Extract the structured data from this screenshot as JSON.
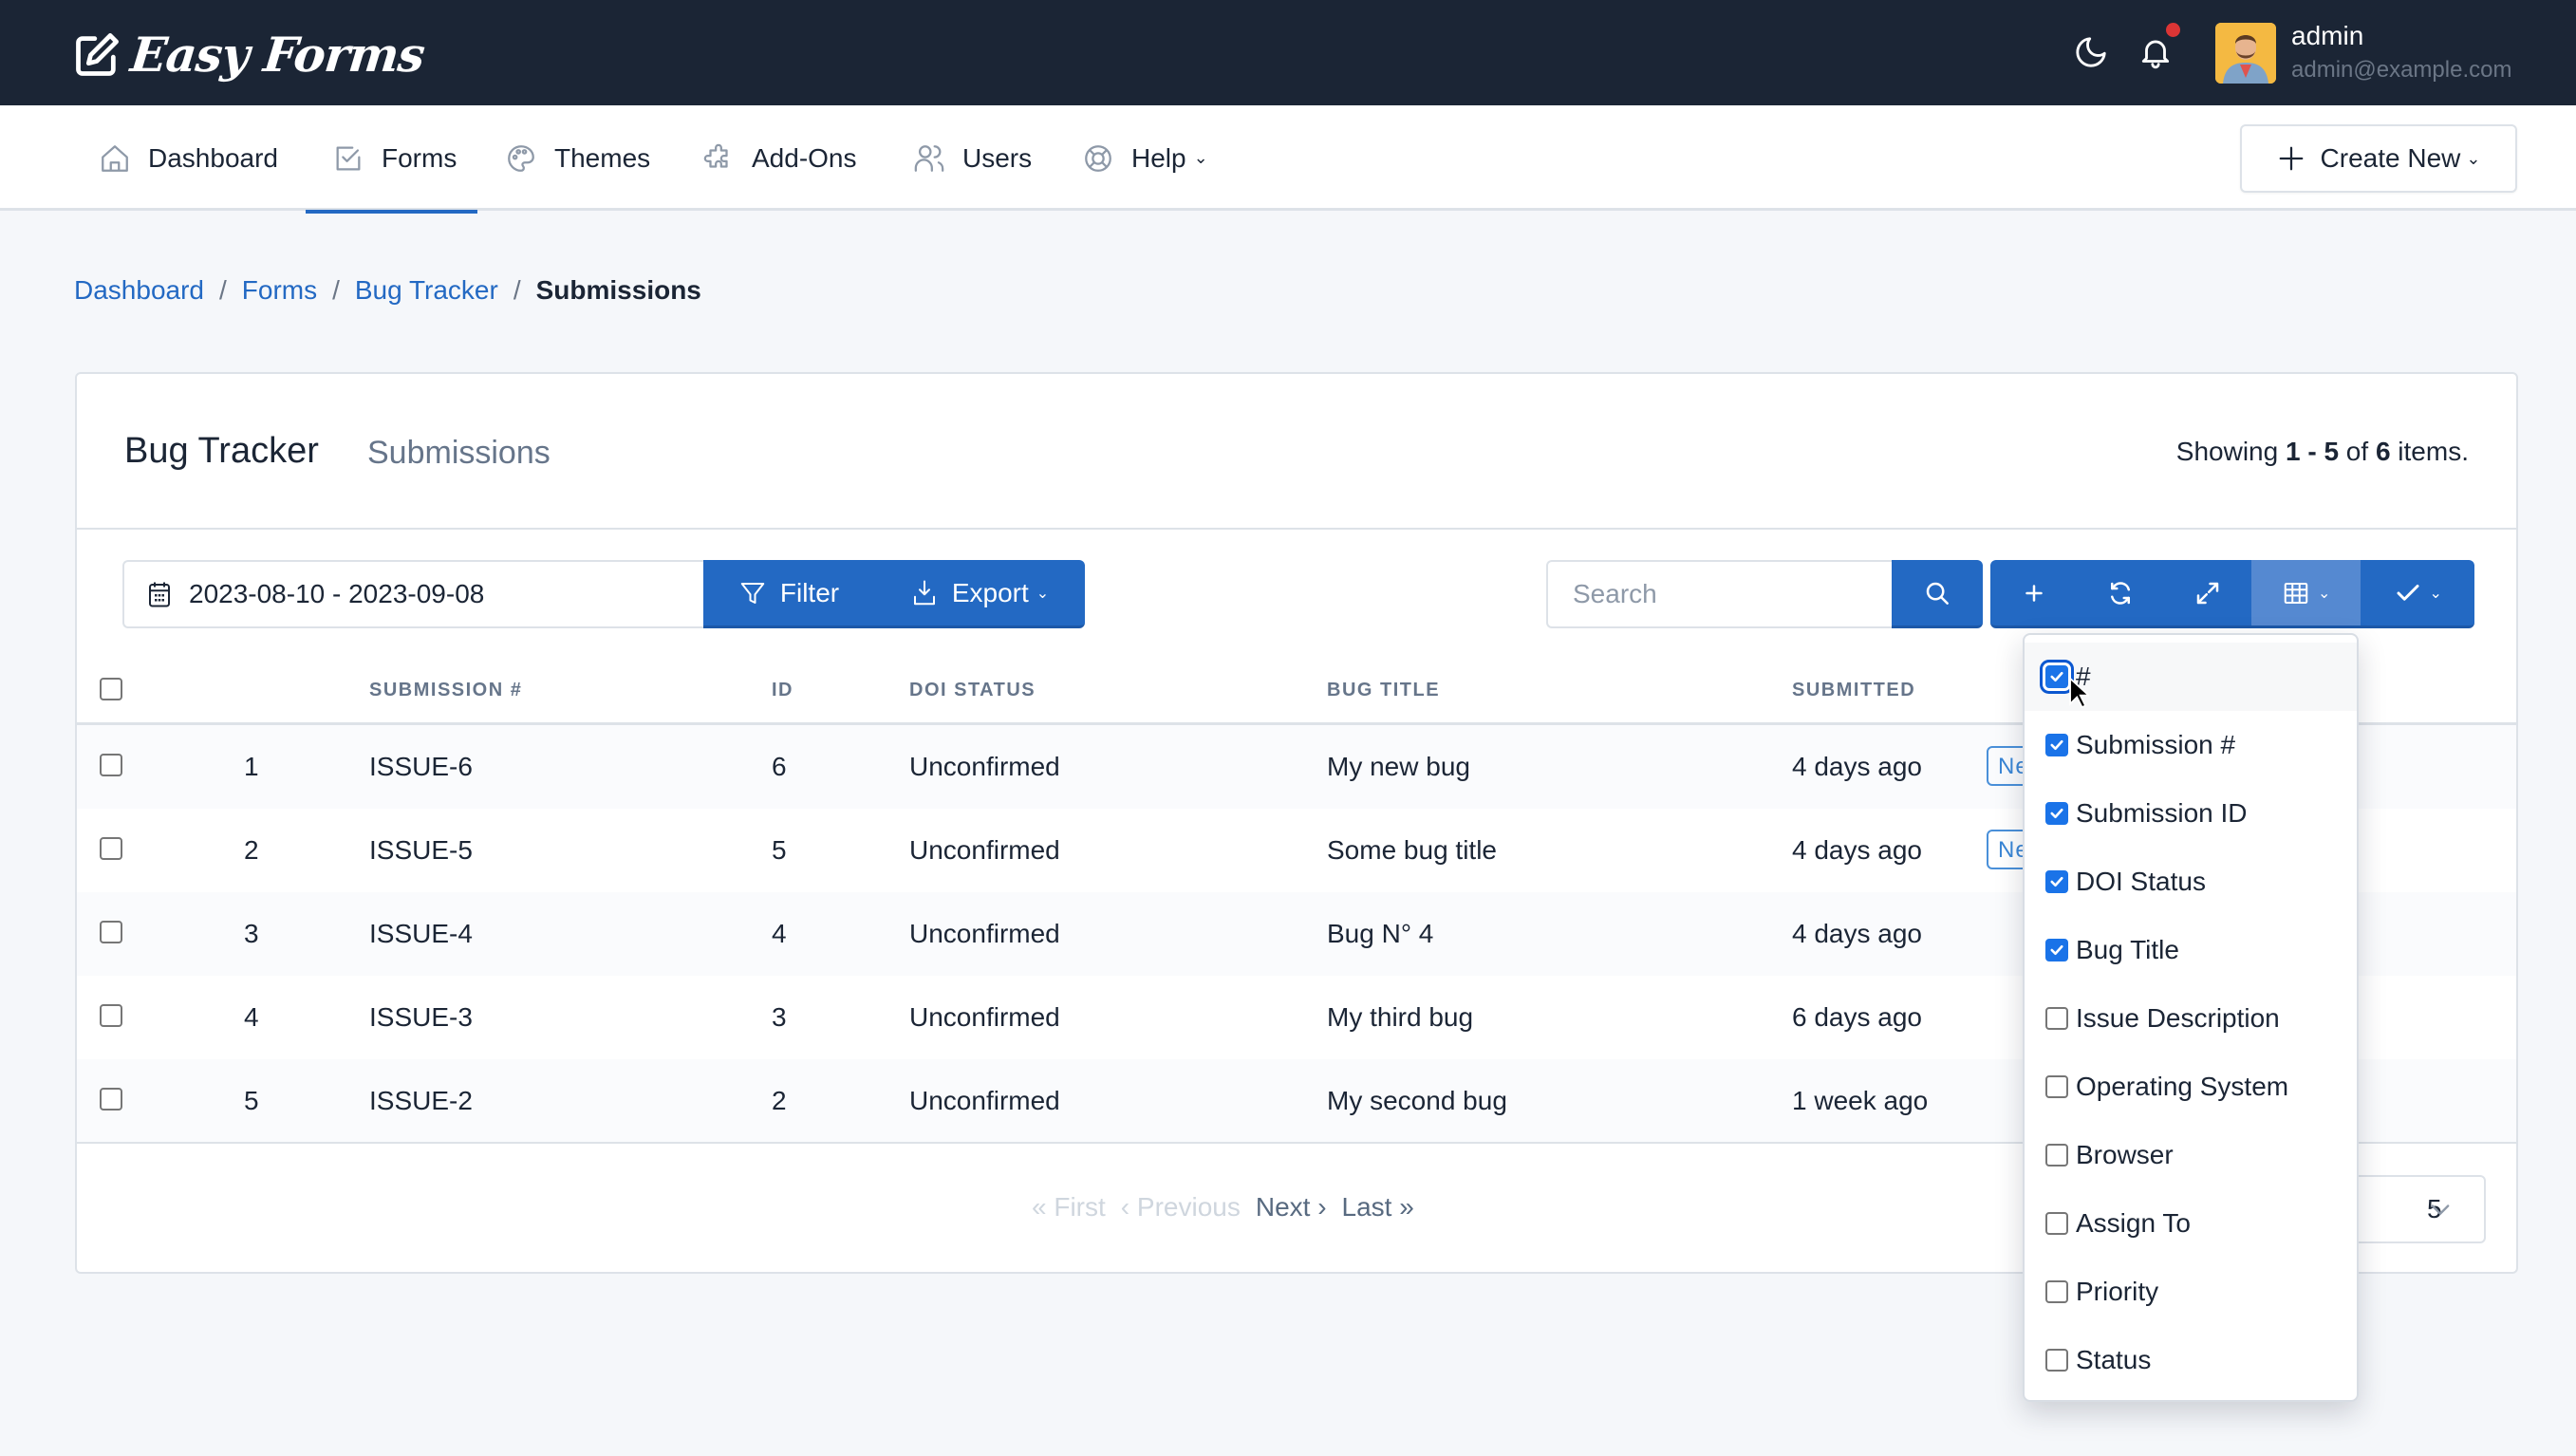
{
  "app": {
    "brand_name": "Easy Forms",
    "user": {
      "name": "admin",
      "email": "admin@example.com"
    },
    "icons": {
      "theme_toggle": "moon-icon",
      "notifications": "bell-icon",
      "notification_dot_color": "#dc3535"
    }
  },
  "nav": {
    "items": [
      {
        "label": "Dashboard",
        "icon": "home-icon"
      },
      {
        "label": "Forms",
        "icon": "checkbox-icon",
        "active": true
      },
      {
        "label": "Themes",
        "icon": "palette-icon"
      },
      {
        "label": "Add-Ons",
        "icon": "puzzle-icon"
      },
      {
        "label": "Users",
        "icon": "users-icon"
      },
      {
        "label": "Help",
        "icon": "lifebuoy-icon",
        "has_dropdown": true
      }
    ],
    "create_new_label": "Create New"
  },
  "breadcrumb": [
    {
      "label": "Dashboard",
      "link": true
    },
    {
      "label": "Forms",
      "link": true
    },
    {
      "label": "Bug Tracker",
      "link": true
    },
    {
      "label": "Submissions",
      "link": false
    }
  ],
  "card": {
    "title": "Bug Tracker",
    "subtitle": "Submissions",
    "summary": {
      "prefix": "Showing ",
      "from": "1",
      "dash": " - ",
      "to": "5",
      "of": " of ",
      "total": "6",
      "suffix": " items."
    }
  },
  "toolbar": {
    "date_range": "2023-08-10 - 2023-09-08",
    "filter_label": "Filter",
    "export_label": "Export",
    "search_placeholder": "Search",
    "search_value": ""
  },
  "table": {
    "headers": {
      "index": "",
      "submission_number": "Submission #",
      "id": "ID",
      "doi_status": "DOI Status",
      "bug_title": "Bug Title",
      "submitted": "Submitted"
    },
    "rows": [
      {
        "index": "1",
        "submission_number": "ISSUE-6",
        "id": "6",
        "doi_status": "Unconfirmed",
        "bug_title": "My new bug",
        "submitted": "4 days ago",
        "badge": "New"
      },
      {
        "index": "2",
        "submission_number": "ISSUE-5",
        "id": "5",
        "doi_status": "Unconfirmed",
        "bug_title": "Some bug title",
        "submitted": "4 days ago",
        "badge": "New"
      },
      {
        "index": "3",
        "submission_number": "ISSUE-4",
        "id": "4",
        "doi_status": "Unconfirmed",
        "bug_title": "Bug N° 4",
        "submitted": "4 days ago",
        "badge": null
      },
      {
        "index": "4",
        "submission_number": "ISSUE-3",
        "id": "3",
        "doi_status": "Unconfirmed",
        "bug_title": "My third bug",
        "submitted": "6 days ago",
        "badge": null
      },
      {
        "index": "5",
        "submission_number": "ISSUE-2",
        "id": "2",
        "doi_status": "Unconfirmed",
        "bug_title": "My second bug",
        "submitted": "1 week ago",
        "badge": null
      }
    ]
  },
  "pagination": {
    "first": "First",
    "previous": "Previous",
    "next": "Next",
    "last": "Last",
    "first_enabled": false,
    "previous_enabled": false,
    "next_enabled": true,
    "last_enabled": true,
    "page_size": "5"
  },
  "column_menu": {
    "items": [
      {
        "label": "#",
        "checked": true
      },
      {
        "label": "Submission #",
        "checked": true
      },
      {
        "label": "Submission ID",
        "checked": true
      },
      {
        "label": "DOI Status",
        "checked": true
      },
      {
        "label": "Bug Title",
        "checked": true
      },
      {
        "label": "Issue Description",
        "checked": false
      },
      {
        "label": "Operating System",
        "checked": false
      },
      {
        "label": "Browser",
        "checked": false
      },
      {
        "label": "Assign To",
        "checked": false
      },
      {
        "label": "Priority",
        "checked": false
      },
      {
        "label": "Status",
        "checked": false
      }
    ]
  },
  "colors": {
    "topbar": "#1b2535",
    "primary": "#2369c3",
    "primary_active": "#5589d1",
    "badge": "#3a86d6",
    "checkbox_checked": "#1a73e8"
  }
}
